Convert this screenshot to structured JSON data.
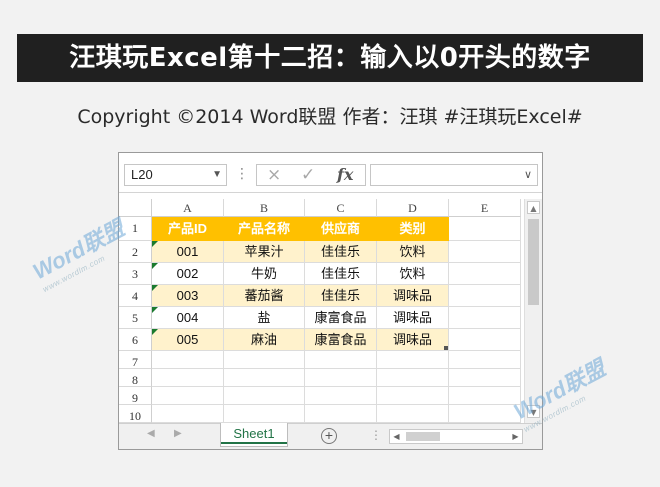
{
  "banner": {
    "title": "汪琪玩Excel第十二招：输入以0开头的数字"
  },
  "subline": {
    "text": "Copyright ©2014 Word联盟    作者：汪琪   #汪琪玩Excel#"
  },
  "formula_bar": {
    "name_box": "L20",
    "cancel_icon": "×",
    "enter_icon": "✓",
    "fx_label": "fx",
    "formula_value": ""
  },
  "columns": [
    "A",
    "B",
    "C",
    "D",
    "E"
  ],
  "rows": [
    "1",
    "2",
    "3",
    "4",
    "5",
    "6",
    "7",
    "8",
    "9",
    "10"
  ],
  "table": {
    "headers": [
      "产品ID",
      "产品名称",
      "供应商",
      "类别"
    ],
    "rows": [
      [
        "001",
        "苹果汁",
        "佳佳乐",
        "饮料"
      ],
      [
        "002",
        "牛奶",
        "佳佳乐",
        "饮料"
      ],
      [
        "003",
        "蕃茄酱",
        "佳佳乐",
        "调味品"
      ],
      [
        "004",
        "盐",
        "康富食品",
        "调味品"
      ],
      [
        "005",
        "麻油",
        "康富食品",
        "调味品"
      ]
    ]
  },
  "sheet_tab": {
    "label": "Sheet1",
    "add_label": "+"
  },
  "watermark": {
    "brand": "Word联盟",
    "url": "www.wordlm.com"
  },
  "colors": {
    "header_fill": "#ffc000",
    "band_fill": "#fff2cc",
    "sheet_accent": "#217346"
  }
}
